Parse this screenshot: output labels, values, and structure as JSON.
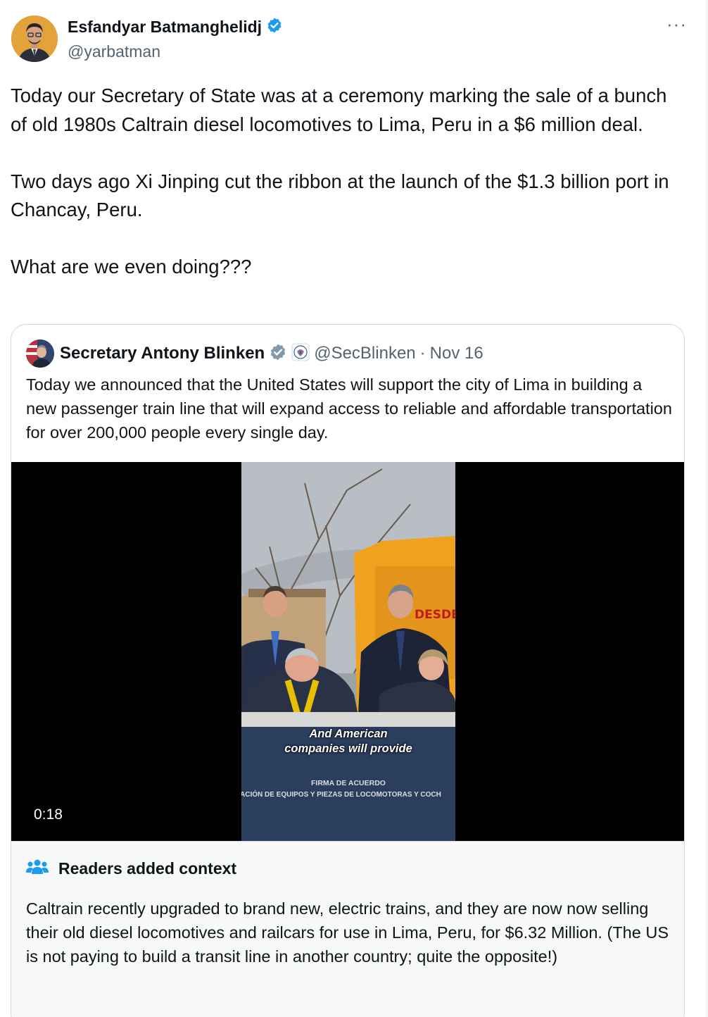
{
  "author": {
    "display_name": "Esfandyar Batmanghelidj",
    "handle": "@yarbatman",
    "verified_badge_color": "#1d9bf0"
  },
  "more_label": "···",
  "tweet": {
    "text": "Today our Secretary of State was at a ceremony marking the sale of a bunch of old 1980s Caltrain diesel locomotives to Lima, Peru in a $6 million deal.\n\nTwo days ago Xi Jinping cut the ribbon at the launch of the $1.3 billion port in Chancay, Peru.\n\nWhat are we even doing???"
  },
  "quoted": {
    "display_name": "Secretary Antony Blinken",
    "handle": "@SecBlinken",
    "separator": "·",
    "date": "Nov 16",
    "verified_badge_color": "#829aab",
    "text": "Today we announced that the United States will support the city of Lima in building a new passenger train line that will expand access to reliable and affordable transportation for over 200,000 people every single day.",
    "video": {
      "caption_line1": "And American",
      "caption_line2": "companies will provide",
      "sign_line1": "FIRMA DE ACUERDO",
      "sign_line2": "ACIÓN DE EQUIPOS Y PIEZAS DE LOCOMOTORAS Y COCH",
      "locomotive_text": "DESDE EL",
      "duration": "0:18"
    }
  },
  "context": {
    "title": "Readers added context",
    "icon_color": "#1d9bf0",
    "text": "Caltrain recently upgraded to brand new, electric trains, and they are now now selling their old diesel locomotives and railcars for use in Lima, Peru, for $6.32 Million. (The US is not paying to build a transit line in another country; quite the opposite!)"
  }
}
